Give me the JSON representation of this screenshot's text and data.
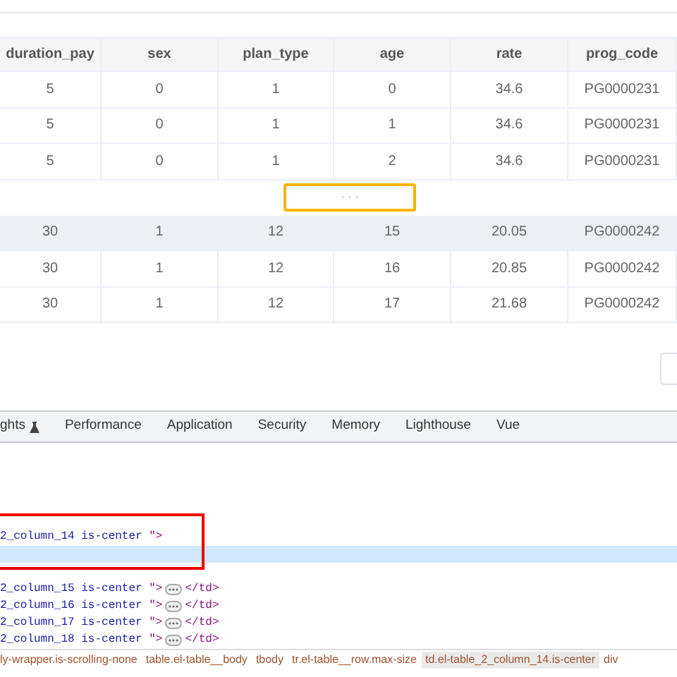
{
  "table": {
    "columns": [
      "duration_pay",
      "sex",
      "plan_type",
      "age",
      "rate",
      "prog_code"
    ],
    "rows": [
      {
        "cells": [
          "5",
          "0",
          "1",
          "0",
          "34.6",
          "PG0000231"
        ],
        "hovered": false
      },
      {
        "cells": [
          "5",
          "0",
          "1",
          "1",
          "34.6",
          "PG0000231"
        ],
        "hovered": false
      },
      {
        "cells": [
          "5",
          "0",
          "1",
          "2",
          "34.6",
          "PG0000231"
        ],
        "hovered": false
      },
      {
        "kind": "gap",
        "text": "· · ·",
        "focused": true
      },
      {
        "cells": [
          "30",
          "1",
          "12",
          "15",
          "20.05",
          "PG0000242"
        ],
        "hovered": true
      },
      {
        "cells": [
          "30",
          "1",
          "12",
          "16",
          "20.85",
          "PG0000242"
        ],
        "hovered": false
      },
      {
        "cells": [
          "30",
          "1",
          "12",
          "17",
          "21.68",
          "PG0000242"
        ],
        "hovered": false
      }
    ]
  },
  "devtools": {
    "tabs": [
      {
        "label": "ghts",
        "icon": true,
        "selected": false
      },
      {
        "label": "Performance",
        "selected": false
      },
      {
        "label": "Application",
        "selected": false
      },
      {
        "label": "Security",
        "selected": false
      },
      {
        "label": "Memory",
        "selected": false
      },
      {
        "label": "Lighthouse",
        "selected": false
      },
      {
        "label": "Vue",
        "selected": false
      }
    ],
    "lines": [
      {
        "value": "2_column_14 is-center ",
        "tag_end": "\">",
        "selected": false,
        "framed": true
      },
      {
        "selected": true,
        "framed": true
      },
      {
        "value": "2_column_15 is-center ",
        "tag_end": "\">",
        "collapsed": true,
        "close": "</td>",
        "selected": false
      },
      {
        "value": "2_column_16 is-center ",
        "tag_end": "\">",
        "collapsed": true,
        "close": "</td>",
        "selected": false
      },
      {
        "value": "2_column_17 is-center ",
        "tag_end": "\">",
        "collapsed": true,
        "close": "</td>",
        "selected": false
      },
      {
        "value": "2_column_18 is-center ",
        "tag_end": "\">",
        "collapsed": true,
        "close": "</td>",
        "selected": false
      }
    ],
    "breadcrumbs": [
      {
        "label": "ly-wrapper.is-scrolling-none",
        "selected": false
      },
      {
        "label": "table.el-table__body",
        "selected": false
      },
      {
        "label": "tbody",
        "selected": false
      },
      {
        "label": "tr.el-table__row.max-size",
        "selected": false
      },
      {
        "label": "td.el-table_2_column_14.is-center",
        "selected": true
      },
      {
        "label": "div",
        "selected": false
      }
    ]
  }
}
